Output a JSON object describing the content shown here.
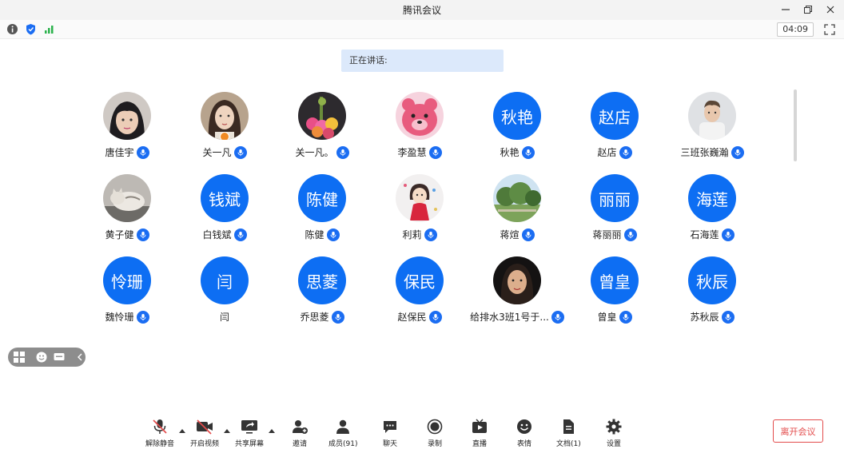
{
  "window": {
    "title": "腾讯会议"
  },
  "status": {
    "timer": "04:09"
  },
  "speaking": {
    "label": "正在讲话:"
  },
  "participants": [
    {
      "name": "唐佳宇",
      "avatar": "photo",
      "photo": "girl-face"
    },
    {
      "name": "关一凡",
      "avatar": "photo",
      "photo": "woman-portrait",
      "host": true
    },
    {
      "name": "关一凡。",
      "avatar": "photo",
      "photo": "flowers"
    },
    {
      "name": "李盈慧",
      "avatar": "photo",
      "photo": "pink-bear"
    },
    {
      "name": "秋艳",
      "avatar": "text",
      "text": "秋艳"
    },
    {
      "name": "赵店",
      "avatar": "text",
      "text": "赵店"
    },
    {
      "name": "三班张巍瀚",
      "avatar": "photo",
      "photo": "boy-shirt"
    },
    {
      "name": "黄子健",
      "avatar": "photo",
      "photo": "cat"
    },
    {
      "name": "白钱斌",
      "avatar": "text",
      "text": "钱斌"
    },
    {
      "name": "陈健",
      "avatar": "text",
      "text": "陈健"
    },
    {
      "name": "利莉",
      "avatar": "photo",
      "photo": "cartoon-girl"
    },
    {
      "name": "蒋煊",
      "avatar": "photo",
      "photo": "trees"
    },
    {
      "name": "蒋丽丽",
      "avatar": "text",
      "text": "丽丽"
    },
    {
      "name": "石海莲",
      "avatar": "text",
      "text": "海莲"
    },
    {
      "name": "魏怜珊",
      "avatar": "text",
      "text": "怜珊"
    },
    {
      "name": "闫",
      "avatar": "text",
      "text": "闫",
      "no_mic": true
    },
    {
      "name": "乔思菱",
      "avatar": "text",
      "text": "思菱"
    },
    {
      "name": "赵保民",
      "avatar": "text",
      "text": "保民"
    },
    {
      "name": "给排水3班1号于...",
      "avatar": "photo",
      "photo": "woman-dark"
    },
    {
      "name": "曾皇",
      "avatar": "text",
      "text": "曾皇"
    },
    {
      "name": "苏秋辰",
      "avatar": "text",
      "text": "秋辰"
    }
  ],
  "toolbar": {
    "unmute": "解除静音",
    "start_video": "开启视频",
    "share_screen": "共享屏幕",
    "invite": "邀请",
    "members": "成员(91)",
    "chat": "聊天",
    "record": "录制",
    "live": "直播",
    "reactions": "表情",
    "docs": "文档(1)",
    "settings": "设置",
    "leave": "离开会议"
  },
  "colors": {
    "accent": "#0d6ef3",
    "leave": "#e34b4b",
    "speaking_bg": "#dce9fb"
  }
}
